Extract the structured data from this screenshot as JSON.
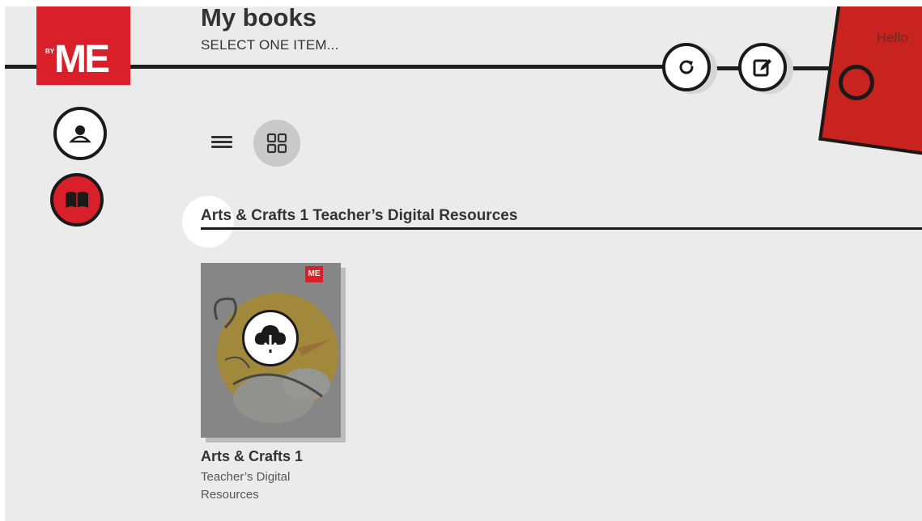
{
  "header": {
    "title": "My books",
    "subtitle": "SELECT ONE ITEM...",
    "greeting": "Hello"
  },
  "logo": {
    "small": "BY",
    "main": "ME"
  },
  "toolbar": {
    "refresh_icon": "refresh-icon",
    "edit_icon": "edit-icon"
  },
  "sidebar": {
    "items": [
      {
        "name": "user",
        "icon": "user-icon"
      },
      {
        "name": "books",
        "icon": "book-icon",
        "active": true
      }
    ]
  },
  "view_toggle": {
    "options": [
      "list",
      "grid"
    ],
    "selected": "grid"
  },
  "section": {
    "title": "Arts & Crafts 1 Teacher’s Digital Resources"
  },
  "books": [
    {
      "title": "Arts & Crafts 1",
      "description": "Teacher’s Digital Resources",
      "cover_badge": "ME",
      "action_icon": "cloud-download-icon"
    }
  ],
  "colors": {
    "brand_red": "#d9202a",
    "background": "#ebebeb",
    "dark": "#1a1a1a"
  }
}
